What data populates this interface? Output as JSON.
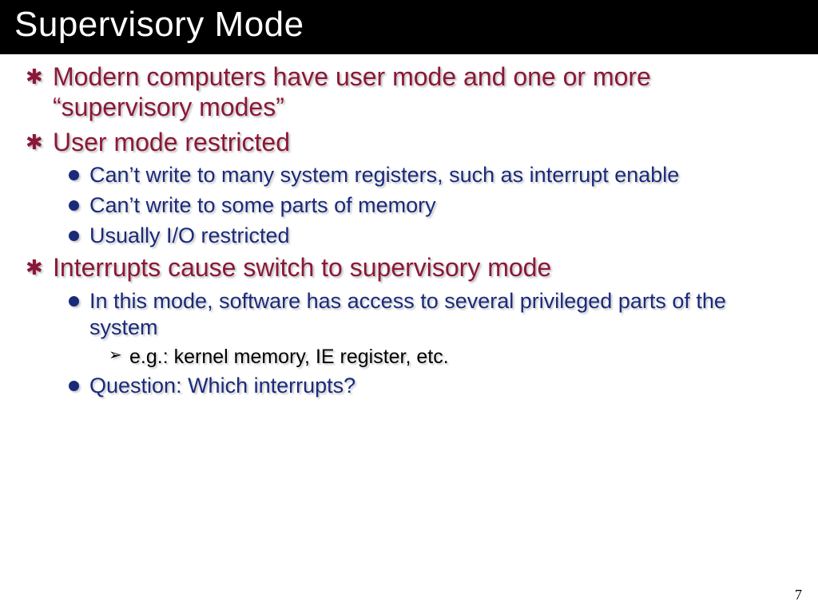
{
  "title": "Supervisory Mode",
  "bullets": {
    "b0": "Modern computers have user mode and one or more “supervisory modes”",
    "b1": "User mode restricted",
    "b1_0": "Can’t write to many system registers, such as interrupt enable",
    "b1_1": "Can’t write to some parts of memory",
    "b1_2": "Usually I/O restricted",
    "b2": "Interrupts cause switch to supervisory mode",
    "b2_0": "In this mode, software has access to several privileged parts of the system",
    "b2_0_0": "e.g.:  kernel memory, IE register, etc.",
    "b2_1": "Question:  Which interrupts?"
  },
  "page_number": "7"
}
